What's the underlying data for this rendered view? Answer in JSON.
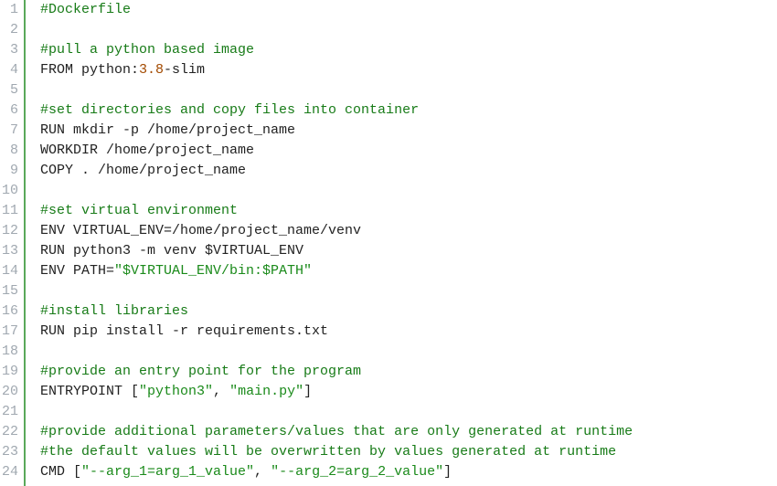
{
  "code": {
    "lines": [
      {
        "num": "1",
        "tokens": [
          {
            "cls": "tok-comment",
            "text": "#Dockerfile"
          }
        ]
      },
      {
        "num": "2",
        "tokens": []
      },
      {
        "num": "3",
        "tokens": [
          {
            "cls": "tok-comment",
            "text": "#pull a python based image"
          }
        ]
      },
      {
        "num": "4",
        "tokens": [
          {
            "cls": "tok-plain",
            "text": "FROM python:"
          },
          {
            "cls": "tok-number",
            "text": "3.8"
          },
          {
            "cls": "tok-plain",
            "text": "-slim"
          }
        ]
      },
      {
        "num": "5",
        "tokens": []
      },
      {
        "num": "6",
        "tokens": [
          {
            "cls": "tok-comment",
            "text": "#set directories and copy files into container"
          }
        ]
      },
      {
        "num": "7",
        "tokens": [
          {
            "cls": "tok-plain",
            "text": "RUN mkdir -p /home/project_name"
          }
        ]
      },
      {
        "num": "8",
        "tokens": [
          {
            "cls": "tok-plain",
            "text": "WORKDIR /home/project_name"
          }
        ]
      },
      {
        "num": "9",
        "tokens": [
          {
            "cls": "tok-plain",
            "text": "COPY . /home/project_name"
          }
        ]
      },
      {
        "num": "10",
        "tokens": []
      },
      {
        "num": "11",
        "tokens": [
          {
            "cls": "tok-comment",
            "text": "#set virtual environment"
          }
        ]
      },
      {
        "num": "12",
        "tokens": [
          {
            "cls": "tok-plain",
            "text": "ENV VIRTUAL_ENV=/home/project_name/venv"
          }
        ]
      },
      {
        "num": "13",
        "tokens": [
          {
            "cls": "tok-plain",
            "text": "RUN python3 -m venv $VIRTUAL_ENV"
          }
        ]
      },
      {
        "num": "14",
        "tokens": [
          {
            "cls": "tok-plain",
            "text": "ENV PATH="
          },
          {
            "cls": "tok-string",
            "text": "\"$VIRTUAL_ENV/bin:$PATH\""
          }
        ]
      },
      {
        "num": "15",
        "tokens": []
      },
      {
        "num": "16",
        "tokens": [
          {
            "cls": "tok-comment",
            "text": "#install libraries"
          }
        ]
      },
      {
        "num": "17",
        "tokens": [
          {
            "cls": "tok-plain",
            "text": "RUN pip install -r requirements.txt"
          }
        ]
      },
      {
        "num": "18",
        "tokens": []
      },
      {
        "num": "19",
        "tokens": [
          {
            "cls": "tok-comment",
            "text": "#provide an entry point for the program"
          }
        ]
      },
      {
        "num": "20",
        "tokens": [
          {
            "cls": "tok-plain",
            "text": "ENTRYPOINT ["
          },
          {
            "cls": "tok-string",
            "text": "\"python3\""
          },
          {
            "cls": "tok-plain",
            "text": ", "
          },
          {
            "cls": "tok-string",
            "text": "\"main.py\""
          },
          {
            "cls": "tok-plain",
            "text": "]"
          }
        ]
      },
      {
        "num": "21",
        "tokens": []
      },
      {
        "num": "22",
        "tokens": [
          {
            "cls": "tok-comment",
            "text": "#provide additional parameters/values that are only generated at runtime"
          }
        ]
      },
      {
        "num": "23",
        "tokens": [
          {
            "cls": "tok-comment",
            "text": "#the default values will be overwritten by values generated at runtime"
          }
        ]
      },
      {
        "num": "24",
        "tokens": [
          {
            "cls": "tok-plain",
            "text": "CMD ["
          },
          {
            "cls": "tok-string",
            "text": "\"--arg_1=arg_1_value\""
          },
          {
            "cls": "tok-plain",
            "text": ", "
          },
          {
            "cls": "tok-string",
            "text": "\"--arg_2=arg_2_value\""
          },
          {
            "cls": "tok-plain",
            "text": "]"
          }
        ]
      }
    ]
  }
}
